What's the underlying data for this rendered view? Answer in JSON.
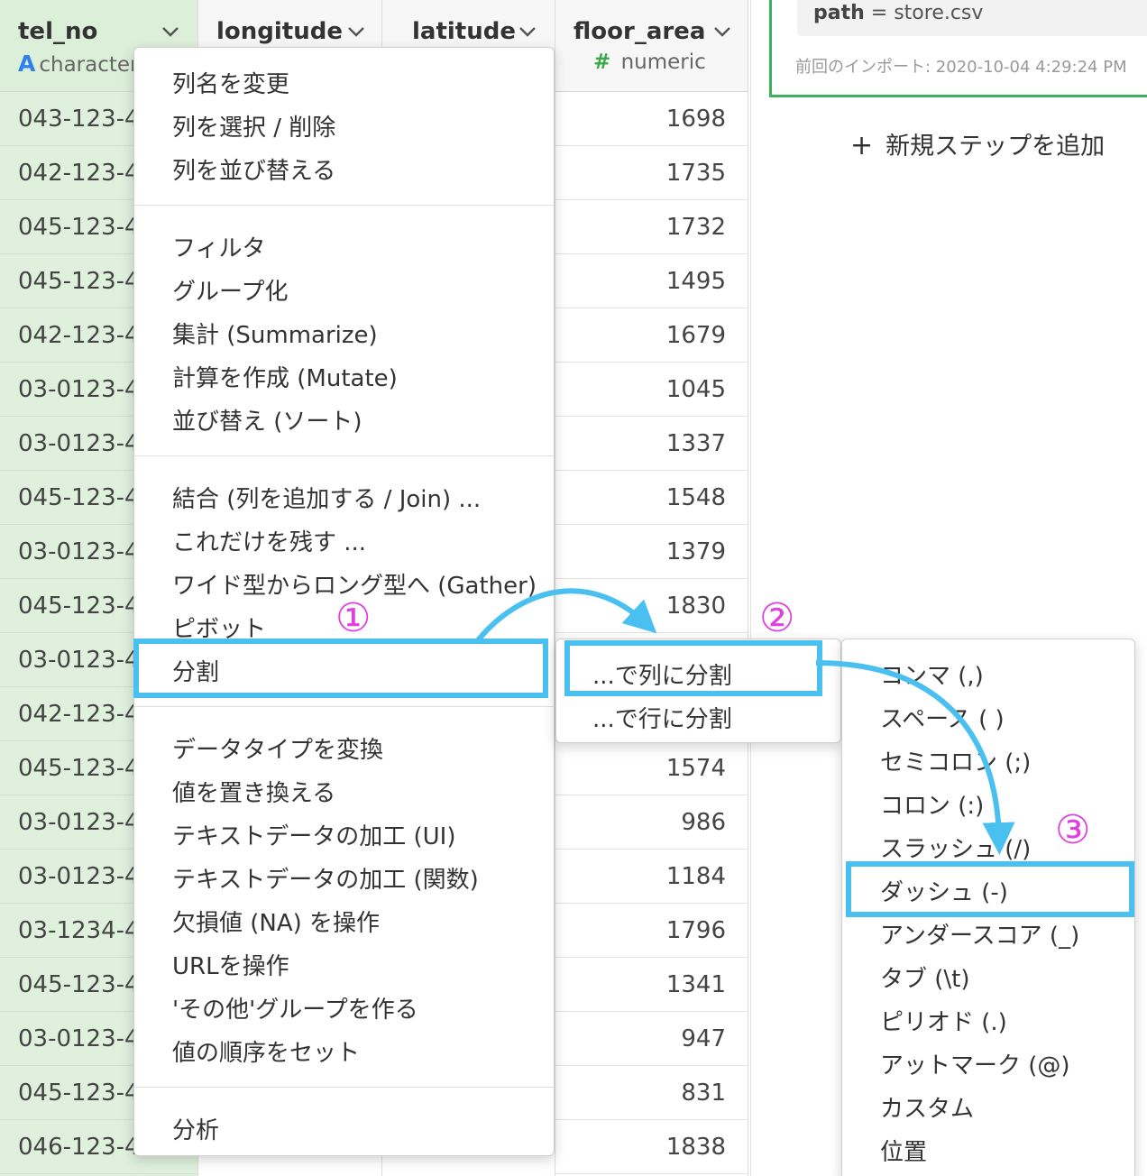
{
  "grid": {
    "columns": [
      {
        "name": "tel_no",
        "type_icon": "A",
        "type": "character"
      },
      {
        "name": "longitude",
        "type_icon": "",
        "type": ""
      },
      {
        "name": "latitude",
        "type_icon": "",
        "type": ""
      },
      {
        "name": "floor_area",
        "type_icon": "#",
        "type": "numeric"
      }
    ],
    "tel_no_values": [
      "043-123-4",
      "042-123-4",
      "045-123-4",
      "045-123-4",
      "042-123-4",
      "03-0123-4",
      "03-0123-4",
      "045-123-4",
      "03-0123-4",
      "045-123-4",
      "03-0123-4",
      "042-123-4",
      "045-123-4",
      "03-0123-4",
      "03-0123-4",
      "03-1234-4",
      "045-123-4",
      "03-0123-4",
      "045-123-4",
      "046-123-4"
    ],
    "floor_area_values": [
      "1698",
      "1735",
      "1732",
      "1495",
      "1679",
      "1045",
      "1337",
      "1548",
      "1379",
      "1830",
      "",
      "",
      "1574",
      "986",
      "1184",
      "1796",
      "1341",
      "947",
      "831",
      "1838"
    ]
  },
  "side": {
    "path_key": "path",
    "path_eq": " = ",
    "path_value": "store.csv",
    "imported": "前回のインポート: 2020-10-04 4:29:24 PM",
    "add_step_icon": "+",
    "add_step": "新規ステップを追加"
  },
  "menu_main": {
    "items": [
      {
        "label": "列名を変更",
        "submenu": false
      },
      {
        "label": "列を選択 / 削除",
        "submenu": false
      },
      {
        "label": "列を並び替える",
        "submenu": false
      },
      {
        "label": "フィルタ",
        "submenu": true
      },
      {
        "label": "グループ化",
        "submenu": false
      },
      {
        "label": "集計 (Summarize)",
        "submenu": false
      },
      {
        "label": "計算を作成 (Mutate)",
        "submenu": false
      },
      {
        "label": "並び替え (ソート)",
        "submenu": true
      },
      {
        "label": "結合 (列を追加する / Join) ...",
        "submenu": false
      },
      {
        "label": "これだけを残す ...",
        "submenu": true
      },
      {
        "label": "ワイド型からロング型へ (Gather)",
        "submenu": true
      },
      {
        "label": "ピボット",
        "submenu": false
      },
      {
        "label": "分割",
        "submenu": false
      },
      {
        "label": "データタイプを変換",
        "submenu": true
      },
      {
        "label": "値を置き換える",
        "submenu": true
      },
      {
        "label": "テキストデータの加工 (UI)",
        "submenu": true
      },
      {
        "label": "テキストデータの加工 (関数)",
        "submenu": true
      },
      {
        "label": "欠損値 (NA) を操作",
        "submenu": true
      },
      {
        "label": "URLを操作",
        "submenu": true
      },
      {
        "label": "'その他'グループを作る",
        "submenu": true
      },
      {
        "label": "値の順序をセット",
        "submenu": true
      },
      {
        "label": "分析",
        "submenu": true
      }
    ]
  },
  "menu_split": {
    "items": [
      {
        "label": "...で列に分割",
        "submenu": false
      },
      {
        "label": "...で行に分割",
        "submenu": true
      }
    ]
  },
  "menu_delim": {
    "items": [
      {
        "label": "コンマ (,)"
      },
      {
        "label": "スペース ( )"
      },
      {
        "label": "セミコロン (;)"
      },
      {
        "label": "コロン (:)"
      },
      {
        "label": "スラッシュ (/)"
      },
      {
        "label": "ダッシュ (-)"
      },
      {
        "label": "アンダースコア (_)"
      },
      {
        "label": "タブ (\\t)"
      },
      {
        "label": "ピリオド (.)"
      },
      {
        "label": "アットマーク (@)"
      },
      {
        "label": "カスタム"
      },
      {
        "label": "位置"
      }
    ]
  },
  "annotations": {
    "step1": "①",
    "step2": "②",
    "step3": "③",
    "highlight_color": "#4ac0f0",
    "badge_color": "#e040e0"
  },
  "colors": {
    "tel_no_bg": "#dff0dd",
    "character_type": "#2f80ed",
    "numeric_type": "#39a849",
    "step_border": "#3fae5e"
  }
}
